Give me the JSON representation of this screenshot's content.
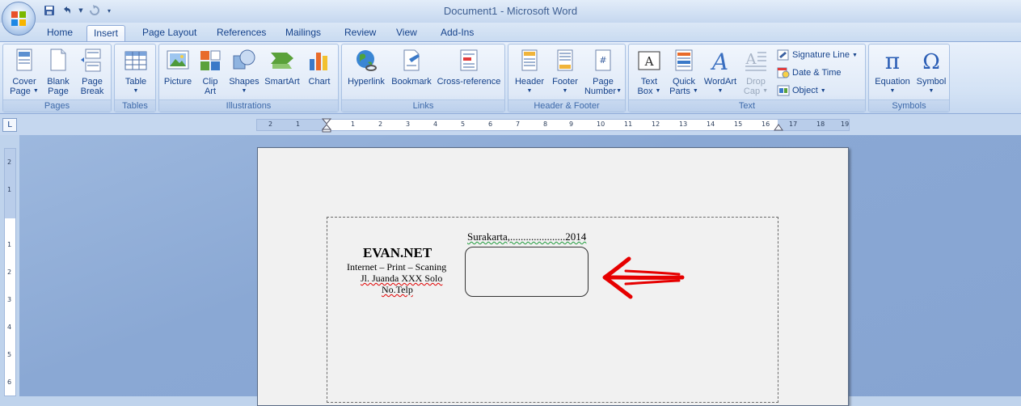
{
  "window": {
    "title": "Document1 - Microsoft Word"
  },
  "tabs": [
    {
      "label": "Home"
    },
    {
      "label": "Insert"
    },
    {
      "label": "Page Layout"
    },
    {
      "label": "References"
    },
    {
      "label": "Mailings"
    },
    {
      "label": "Review"
    },
    {
      "label": "View"
    },
    {
      "label": "Add-Ins"
    }
  ],
  "active_tab": "Insert",
  "ribbon": {
    "pages": {
      "label": "Pages",
      "cover_l1": "Cover",
      "cover_l2": "Page",
      "blank_l1": "Blank",
      "blank_l2": "Page",
      "break_l1": "Page",
      "break_l2": "Break"
    },
    "tables": {
      "label": "Tables",
      "table": "Table"
    },
    "illustrations": {
      "label": "Illustrations",
      "picture": "Picture",
      "clipart_l1": "Clip",
      "clipart_l2": "Art",
      "shapes": "Shapes",
      "smartart": "SmartArt",
      "chart": "Chart"
    },
    "links": {
      "label": "Links",
      "hyperlink": "Hyperlink",
      "bookmark": "Bookmark",
      "crossref": "Cross-reference"
    },
    "headerfooter": {
      "label": "Header & Footer",
      "header": "Header",
      "footer": "Footer",
      "pagenum_l1": "Page",
      "pagenum_l2": "Number"
    },
    "text": {
      "label": "Text",
      "textbox_l1": "Text",
      "textbox_l2": "Box",
      "quick_l1": "Quick",
      "quick_l2": "Parts",
      "wordart": "WordArt",
      "dropcap_l1": "Drop",
      "dropcap_l2": "Cap",
      "signature": "Signature Line",
      "datetime": "Date & Time",
      "object": "Object"
    },
    "symbols": {
      "label": "Symbols",
      "equation": "Equation",
      "symbol": "Symbol"
    }
  },
  "ruler": {
    "h_ticks": [
      "2",
      "1",
      "1",
      "2",
      "3",
      "4",
      "5",
      "6",
      "7",
      "8",
      "9",
      "10",
      "11",
      "12",
      "13",
      "14",
      "15",
      "16",
      "17",
      "18",
      "19"
    ],
    "v_ticks": [
      "2",
      "1",
      "1",
      "2",
      "3",
      "4",
      "5",
      "6"
    ]
  },
  "document": {
    "place_date": "Surakarta,.....................2014",
    "company": "EVAN.NET",
    "services": "Internet – Print – Scaning",
    "address": "Jl. Juanda XXX Solo",
    "phone": "No.Telp"
  },
  "colors": {
    "annotation_arrow": "#e60000",
    "accent": "#15428b"
  }
}
